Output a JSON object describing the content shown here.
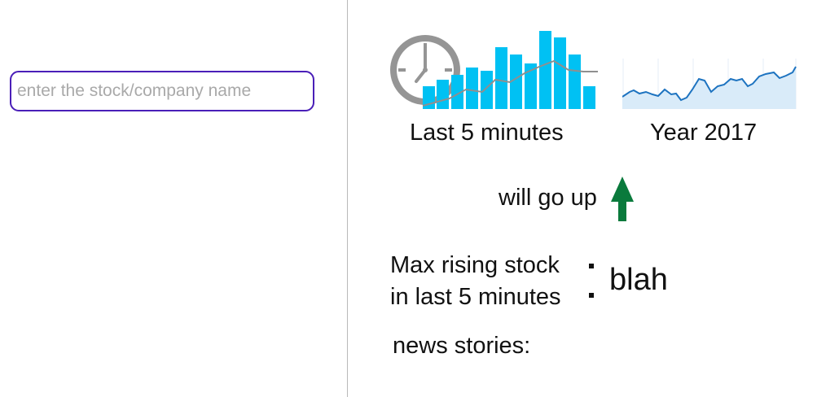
{
  "search": {
    "placeholder": "enter the stock/company name",
    "value": ""
  },
  "charts": {
    "minutes_caption": "Last 5 minutes",
    "year_caption": "Year 2017",
    "minute_chart_icon": "clock-icon",
    "colors": {
      "bar": "#00c1f3",
      "trend_line": "#8f8f8f",
      "clock": "#959595",
      "year_line": "#1d73c0",
      "year_fill": "#d9ebf9"
    }
  },
  "prediction": {
    "text": "will go up",
    "icon": "arrow-up-icon",
    "color": "#0a7a3c"
  },
  "max_rising": {
    "label_line1": "Max rising stock",
    "label_line2": "in last 5 minutes",
    "value": "blah"
  },
  "news": {
    "label": "news stories:"
  }
}
